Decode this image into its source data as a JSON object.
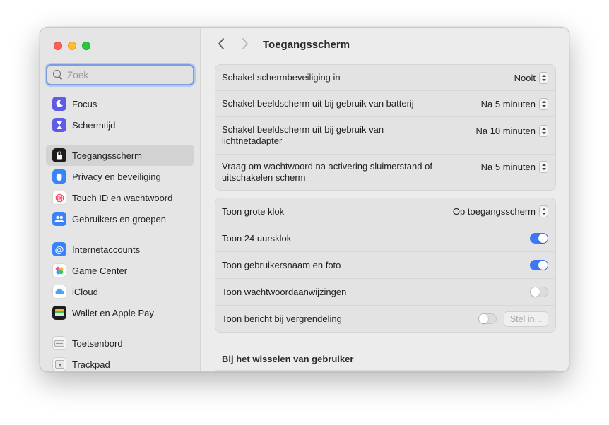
{
  "window": {
    "title": "Toegangsscherm"
  },
  "search": {
    "placeholder": "Zoek",
    "value": ""
  },
  "sidebar": {
    "items": [
      {
        "label": "Focus",
        "icon": "moon-icon",
        "selected": false
      },
      {
        "label": "Schermtijd",
        "icon": "hourglass-icon",
        "selected": false
      },
      {
        "label": "Toegangsscherm",
        "icon": "lock-icon",
        "selected": true
      },
      {
        "label": "Privacy en beveiliging",
        "icon": "hand-icon",
        "selected": false
      },
      {
        "label": "Touch ID en wachtwoord",
        "icon": "fingerprint-icon",
        "selected": false
      },
      {
        "label": "Gebruikers en groepen",
        "icon": "users-icon",
        "selected": false
      },
      {
        "label": "Internetaccounts",
        "icon": "at-icon",
        "selected": false
      },
      {
        "label": "Game Center",
        "icon": "game-center-icon",
        "selected": false
      },
      {
        "label": "iCloud",
        "icon": "cloud-icon",
        "selected": false
      },
      {
        "label": "Wallet en Apple Pay",
        "icon": "wallet-icon",
        "selected": false
      },
      {
        "label": "Toetsenbord",
        "icon": "keyboard-icon",
        "selected": false
      },
      {
        "label": "Trackpad",
        "icon": "trackpad-icon",
        "selected": false
      }
    ]
  },
  "group1": {
    "rows": [
      {
        "label": "Schakel schermbeveiliging in",
        "value": "Nooit"
      },
      {
        "label": "Schakel beeldscherm uit bij gebruik van batterij",
        "value": "Na 5 minuten"
      },
      {
        "label": "Schakel beeldscherm uit bij gebruik van lichtnetadapter",
        "value": "Na 10 minuten"
      },
      {
        "label": "Vraag om wachtwoord na activering sluimerstand of uitschakelen scherm",
        "value": "Na 5 minuten"
      }
    ]
  },
  "group2": {
    "rows": [
      {
        "label": "Toon grote klok",
        "value": "Op toegangsscherm"
      },
      {
        "label": "Toon 24 uursklok",
        "toggle": true
      },
      {
        "label": "Toon gebruikersnaam en foto",
        "toggle": true
      },
      {
        "label": "Toon wachtwoordaanwijzingen",
        "toggle": false
      },
      {
        "label": "Toon bericht bij vergrendeling",
        "toggle": false,
        "button": "Stel in..."
      }
    ]
  },
  "section": {
    "heading": "Bij het wisselen van gebruiker"
  },
  "colors": {
    "accent": "#3b78f1",
    "selected_bg": "#d3d3d3"
  }
}
